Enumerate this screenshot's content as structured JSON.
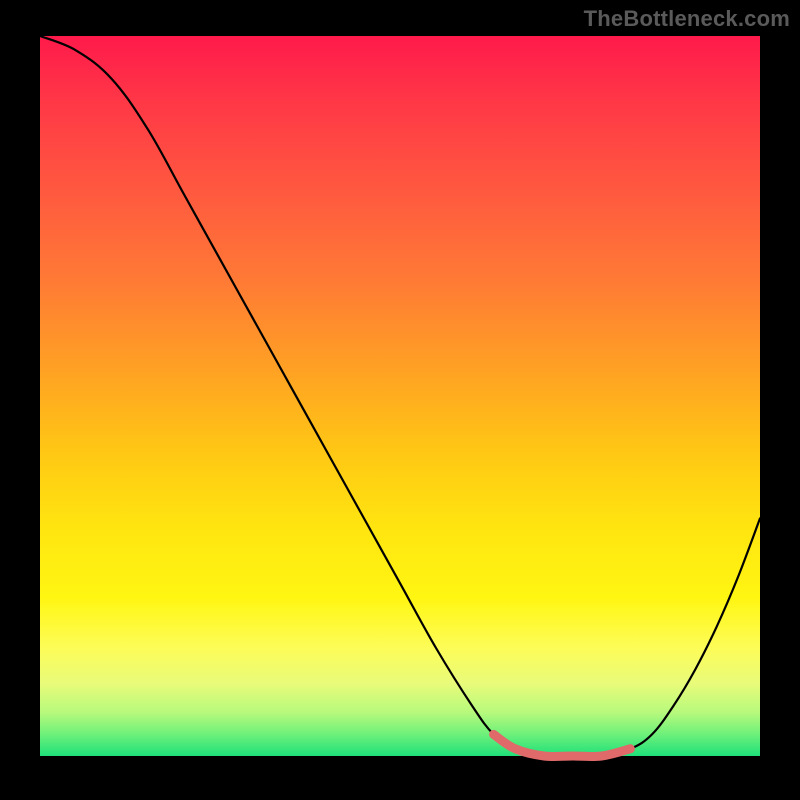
{
  "watermark": "TheBottleneck.com",
  "chart_data": {
    "type": "line",
    "title": "",
    "xlabel": "",
    "ylabel": "",
    "xlim": [
      0,
      100
    ],
    "ylim": [
      0,
      100
    ],
    "series": [
      {
        "name": "bottleneck-curve",
        "color": "#000000",
        "x": [
          0,
          5,
          10,
          15,
          20,
          25,
          30,
          35,
          40,
          45,
          50,
          55,
          60,
          63,
          66,
          70,
          74,
          78,
          82,
          85,
          88,
          91,
          94,
          97,
          100
        ],
        "values": [
          100,
          98,
          94,
          87,
          78,
          69,
          60,
          51,
          42,
          33,
          24,
          15,
          7,
          3,
          1,
          0,
          0,
          0,
          1,
          3,
          7,
          12,
          18,
          25,
          33
        ]
      },
      {
        "name": "optimal-band",
        "color": "#e06a6a",
        "x": [
          63,
          66,
          70,
          74,
          78,
          82
        ],
        "values": [
          3,
          1,
          0,
          0,
          0,
          1
        ]
      }
    ],
    "gradient_stops": [
      {
        "pos": 0,
        "color": "#ff1a4b"
      },
      {
        "pos": 10,
        "color": "#ff3a46"
      },
      {
        "pos": 22,
        "color": "#ff5a3f"
      },
      {
        "pos": 34,
        "color": "#ff7a35"
      },
      {
        "pos": 46,
        "color": "#ffa024"
      },
      {
        "pos": 58,
        "color": "#ffc814"
      },
      {
        "pos": 68,
        "color": "#ffe410"
      },
      {
        "pos": 78,
        "color": "#fff612"
      },
      {
        "pos": 85,
        "color": "#fdfc58"
      },
      {
        "pos": 90,
        "color": "#e8fb7a"
      },
      {
        "pos": 94,
        "color": "#b6f97c"
      },
      {
        "pos": 97,
        "color": "#6df07a"
      },
      {
        "pos": 100,
        "color": "#1fe07a"
      }
    ]
  }
}
